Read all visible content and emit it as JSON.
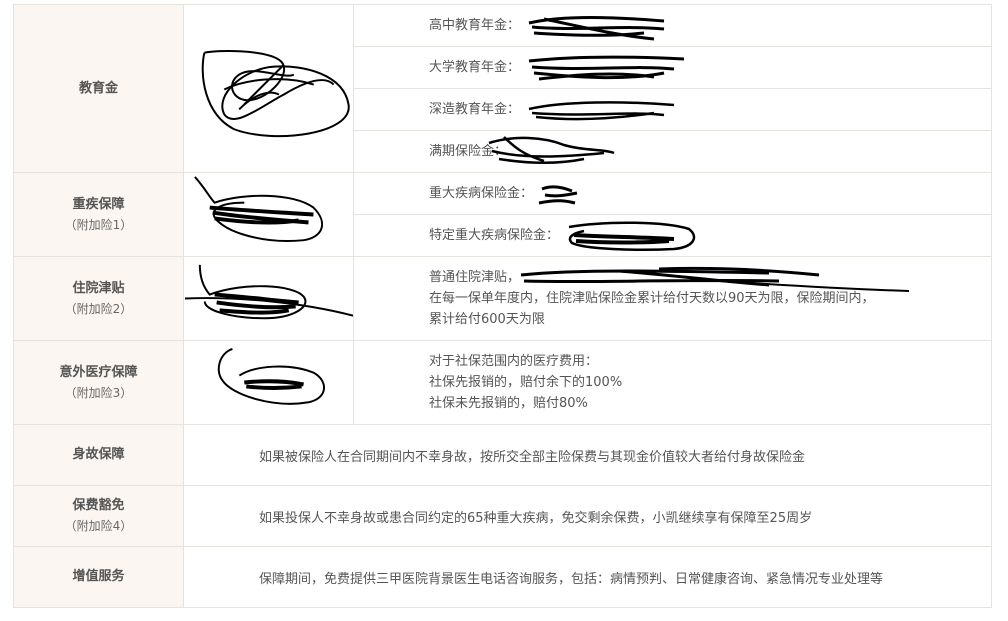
{
  "education": {
    "label": "教育金",
    "rows": [
      {
        "label": "高中教育年金："
      },
      {
        "label": "大学教育年金："
      },
      {
        "label": "深造教育年金："
      },
      {
        "label": "满期保险金："
      }
    ]
  },
  "critical_illness": {
    "label": "重疾保障",
    "sub": "（附加险1）",
    "rows": [
      {
        "label": "重大疾病保险金："
      },
      {
        "label": "特定重大疾病保险金："
      }
    ]
  },
  "hospital": {
    "label": "住院津贴",
    "sub": "（附加险2）",
    "line1": "普通住院津贴，",
    "line2": "在每一保单年度内，住院津贴保险金累计给付天数以90天为限，保险期间内，",
    "line3": "累计给付600天为限"
  },
  "accident": {
    "label": "意外医疗保障",
    "sub": "（附加险3）",
    "line1": "对于社保范围内的医疗费用：",
    "line2": "社保先报销的，赔付余下的100%",
    "line3": "社保未先报销的，赔付80%"
  },
  "death": {
    "label": "身故保障",
    "text": "如果被保险人在合同期间内不幸身故，按所交全部主险保费与其现金价值较大者给付身故保险金"
  },
  "waiver": {
    "label": "保费豁免",
    "sub": "（附加险4）",
    "text": "如果投保人不幸身故或患合同约定的65种重大疾病，免交剩余保费，小凯继续享有保障至25周岁"
  },
  "value_added": {
    "label": "增值服务",
    "text": "保障期间，免费提供三甲医院背景医生电话咨询服务，包括：病情预判、日常健康咨询、紧急情况专业处理等"
  }
}
